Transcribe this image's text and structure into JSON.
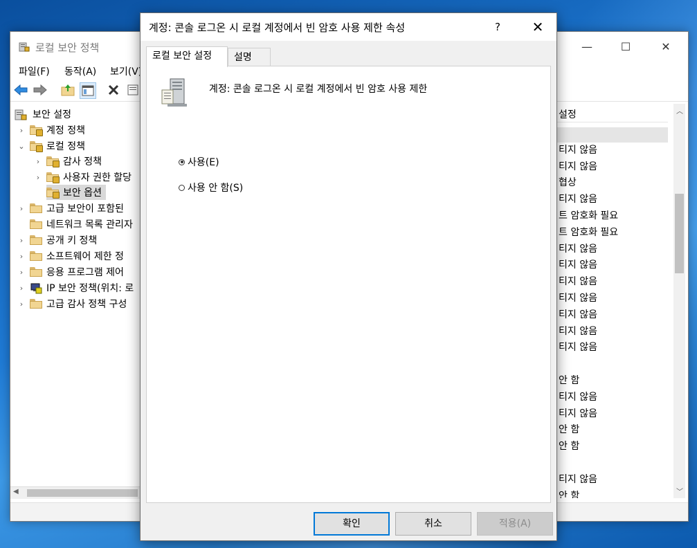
{
  "bg_window": {
    "title": "로컬 보안 정책",
    "menu": [
      "파일(F)",
      "동작(A)",
      "보기(V)"
    ],
    "tree": [
      {
        "label": "보안 설정",
        "level": 0,
        "expanded": true
      },
      {
        "label": "계정 정책",
        "level": 1,
        "expanded": false
      },
      {
        "label": "로컬 정책",
        "level": 1,
        "expanded": true
      },
      {
        "label": "감사 정책",
        "level": 2,
        "expanded": false
      },
      {
        "label": "사용자 권한 할당",
        "level": 2,
        "expanded": false
      },
      {
        "label": "보안 옵션",
        "level": 2,
        "selected": true
      },
      {
        "label": "고급 보안이 포함된",
        "level": 1,
        "expanded": false
      },
      {
        "label": "네트워크 목록 관리자",
        "level": 1
      },
      {
        "label": "공개 키 정책",
        "level": 1,
        "expanded": false
      },
      {
        "label": "소프트웨어 제한 정",
        "level": 1,
        "expanded": false
      },
      {
        "label": "응용 프로그램 제어",
        "level": 1,
        "expanded": false
      },
      {
        "label": "IP 보안 정책(위치: 로",
        "level": 1,
        "expanded": false,
        "icon": "ipsec"
      },
      {
        "label": "고급 감사 정책 구성",
        "level": 1,
        "expanded": false
      }
    ],
    "right_header": "설정",
    "right_values": [
      "",
      "티지 않음",
      "티지 않음",
      "협상",
      "티지 않음",
      "트 암호화 필요",
      "트 암호화 필요",
      "티지 않음",
      "티지 않음",
      "티지 않음",
      "티지 않음",
      "티지 않음",
      "티지 않음",
      "티지 않음",
      "",
      "안 함",
      "티지 않음",
      "티지 않음",
      "안 함",
      "안 함",
      "",
      "티지 않음",
      "안 함"
    ]
  },
  "dialog": {
    "title": "계정: 콘솔 로그온 시 로컬 계정에서 빈 암호 사용 제한 속성",
    "help": "?",
    "close": "✕",
    "tabs": [
      "로컬 보안 설정",
      "설명"
    ],
    "policy_name": "계정: 콘솔 로그온 시 로컬 계정에서 빈 암호 사용 제한",
    "options": [
      {
        "label": "사용(E)",
        "checked": true
      },
      {
        "label": "사용 안 함(S)",
        "checked": false
      }
    ],
    "buttons": {
      "ok": "확인",
      "cancel": "취소",
      "apply": "적용(A)"
    }
  },
  "colors": {
    "accent": "#0078d7",
    "desktop": "#1c6ec4"
  }
}
